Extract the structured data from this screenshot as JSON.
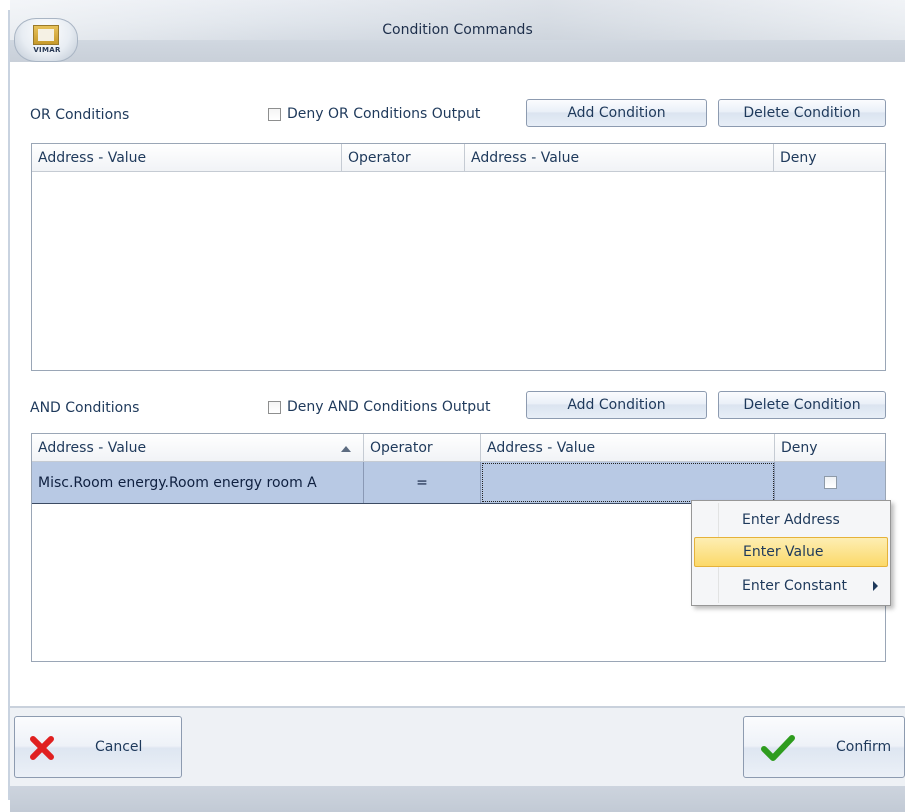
{
  "window": {
    "title": "Condition Commands",
    "logo_text": "VIMAR"
  },
  "or_section": {
    "label": "OR Conditions",
    "deny_label": "Deny OR Conditions Output",
    "add_button": "Add Condition",
    "delete_button": "Delete Condition",
    "columns": [
      "Address - Value",
      "Operator",
      "Address - Value",
      "Deny"
    ],
    "rows": []
  },
  "and_section": {
    "label": "AND Conditions",
    "deny_label": "Deny AND Conditions Output",
    "add_button": "Add Condition",
    "delete_button": "Delete Condition",
    "columns": [
      "Address - Value",
      "Operator",
      "Address - Value",
      "Deny"
    ],
    "rows": [
      {
        "address1": "Misc.Room energy.Room energy room A",
        "operator": "=",
        "address2": "",
        "deny": false
      }
    ]
  },
  "context_menu": {
    "items": [
      {
        "label": "Enter Address",
        "highlighted": false,
        "has_submenu": false
      },
      {
        "label": "Enter Value",
        "highlighted": true,
        "has_submenu": false
      },
      {
        "label": "Enter Constant",
        "highlighted": false,
        "has_submenu": true
      }
    ]
  },
  "footer": {
    "cancel_label": "Cancel",
    "confirm_label": "Confirm"
  },
  "colors": {
    "selection_row": "#b8c9e4",
    "menu_highlight": "#fcd969",
    "cancel_icon": "#e02020",
    "confirm_icon": "#2e9c1e"
  }
}
